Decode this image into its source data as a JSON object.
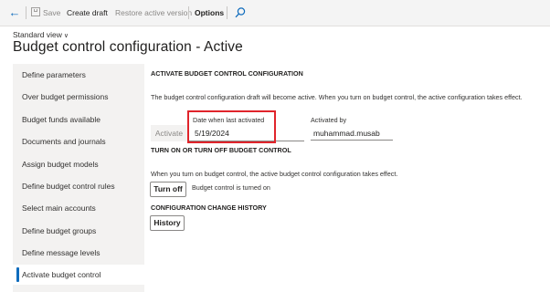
{
  "toolbar": {
    "back_icon": "back-arrow-icon",
    "save_icon": "save-icon",
    "save_label": "Save",
    "create_draft_label": "Create draft",
    "restore_label": "Restore active version",
    "options_label": "Options",
    "search_icon": "search-icon"
  },
  "header": {
    "view_label": "Standard view",
    "view_chevron": "∨",
    "title": "Budget control configuration - Active"
  },
  "sidebar": {
    "items": [
      {
        "label": "Define parameters"
      },
      {
        "label": "Over budget permissions"
      },
      {
        "label": "Budget funds available"
      },
      {
        "label": "Documents and journals"
      },
      {
        "label": "Assign budget models"
      },
      {
        "label": "Define budget control rules"
      },
      {
        "label": "Select main accounts"
      },
      {
        "label": "Define budget groups"
      },
      {
        "label": "Define message levels"
      },
      {
        "label": "Activate budget control"
      }
    ],
    "active_index": 9
  },
  "activate_section": {
    "heading": "ACTIVATE BUDGET CONTROL CONFIGURATION",
    "description": "The budget control configuration draft will become active. When you turn on budget control, the active configuration takes effect.",
    "activate_button": "Activate",
    "date_label": "Date when last activated",
    "date_value": "5/19/2024",
    "activated_by_label": "Activated by",
    "activated_by_value": "muhammad.musab"
  },
  "turn_section": {
    "heading": "TURN ON OR TURN OFF BUDGET CONTROL",
    "description": "When you turn on budget control, the active budget control configuration takes effect.",
    "turn_off_button": "Turn off",
    "status_text": "Budget control is turned on"
  },
  "history_section": {
    "heading": "CONFIGURATION CHANGE HISTORY",
    "history_button": "History"
  },
  "colors": {
    "accent": "#0f6cbd",
    "highlight_box": "#e0242b",
    "sidebar_bg": "#f3f2f1",
    "toolbar_bg": "#f4f4f4"
  }
}
